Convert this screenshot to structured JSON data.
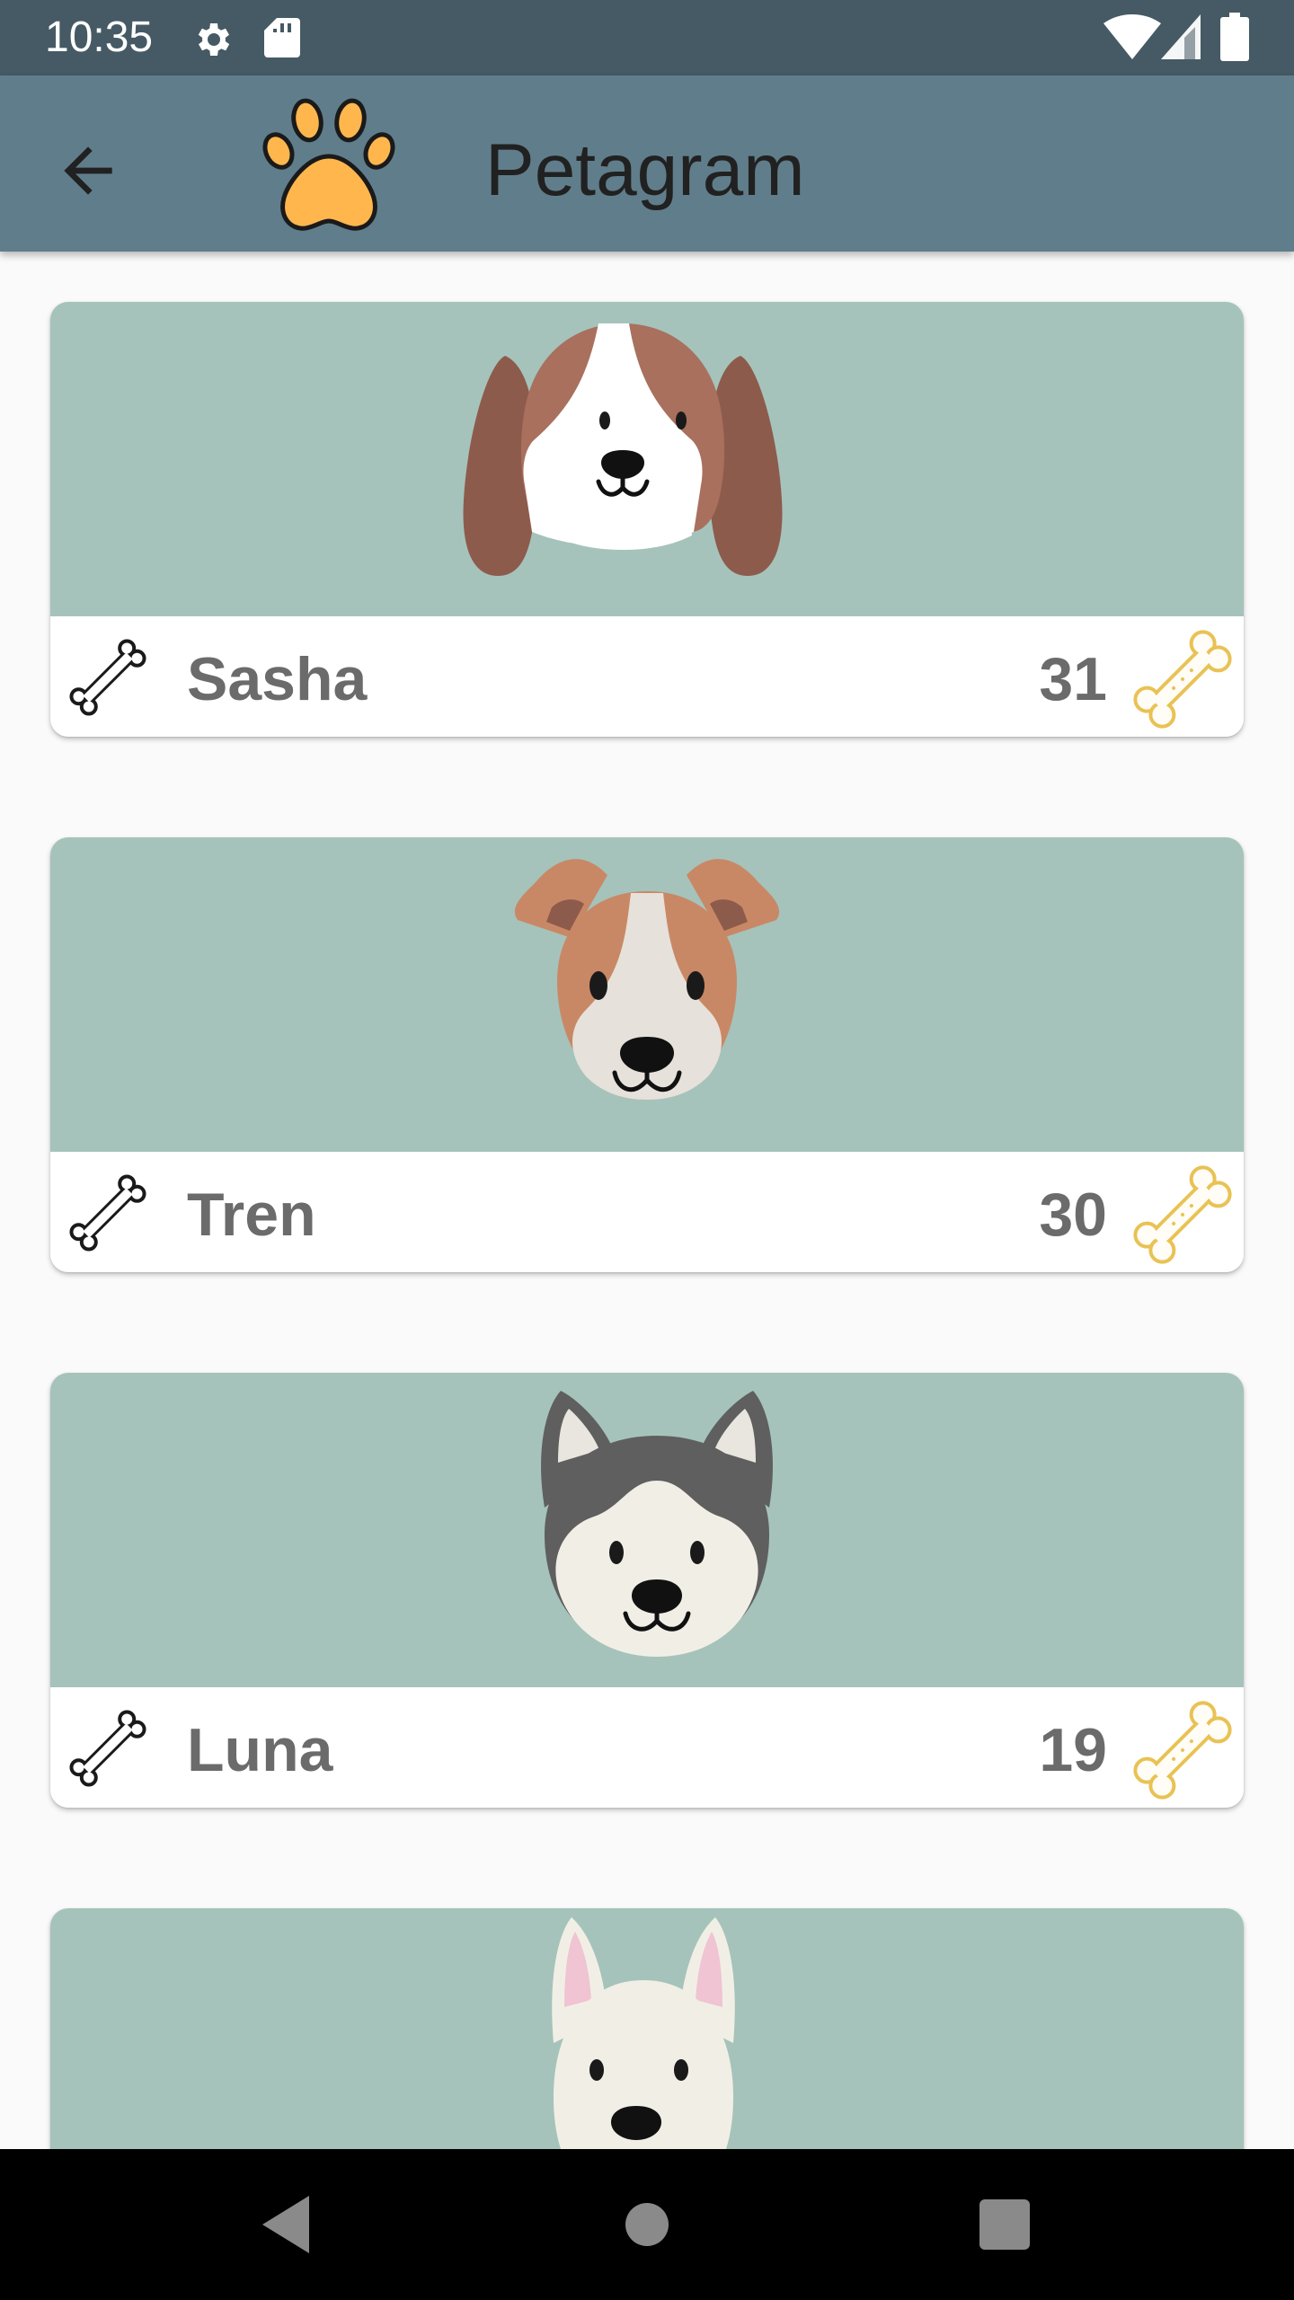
{
  "status_bar": {
    "time": "10:35",
    "left_icons": [
      "settings-icon",
      "sd-card-icon"
    ],
    "right_icons": [
      "wifi-icon",
      "cell-signal-icon",
      "battery-icon"
    ]
  },
  "app_bar": {
    "title": "Petagram",
    "back_icon": "arrow-back-icon",
    "logo_icon": "paw-icon"
  },
  "pets": [
    {
      "name": "Sasha",
      "likes": "31",
      "avatar": "beagle-dog-icon"
    },
    {
      "name": "Tren",
      "likes": "30",
      "avatar": "terrier-dog-icon"
    },
    {
      "name": "Luna",
      "likes": "19",
      "avatar": "husky-dog-icon"
    },
    {
      "name": "",
      "likes": "",
      "avatar": "white-dog-icon"
    }
  ],
  "nav_bar": {
    "buttons": [
      "back-triangle-icon",
      "home-circle-icon",
      "recents-square-icon"
    ]
  },
  "colors": {
    "status_bar": "#455a64",
    "app_bar": "#607d8b",
    "card_image_bg": "#a5c3bb",
    "bone_outline": "#e9c254",
    "text_gray": "#6b6b6b"
  }
}
